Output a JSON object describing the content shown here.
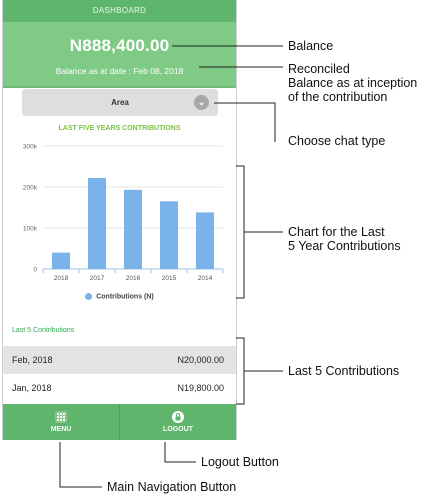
{
  "screen": {
    "header_title": "DASHBOARD",
    "balance": "N888,400.00",
    "balance_date": "Balance as at date : Feb 08, 2018",
    "chart_type_selected": "Area",
    "chart_title": "LAST FIVE YEARS CONTRIBUTIONS",
    "legend_label": "Contributions (N)",
    "last5_title": "Last 5 Contributions",
    "contributions": [
      {
        "date": "Feb, 2018",
        "amount": "N20,000.00"
      },
      {
        "date": "Jan, 2018",
        "amount": "N19,800.00"
      }
    ],
    "nav": {
      "menu": "MENU",
      "logout": "LOGOUT"
    }
  },
  "chart_data": {
    "type": "bar",
    "title": "LAST FIVE YEARS CONTRIBUTIONS",
    "categories": [
      "2018",
      "2017",
      "2016",
      "2015",
      "2014"
    ],
    "series": [
      {
        "name": "Contributions (N)",
        "values": [
          40000,
          222000,
          193000,
          165000,
          138000
        ]
      }
    ],
    "y_ticks": [
      "0",
      "100k",
      "200k",
      "300k"
    ],
    "ylim": [
      0,
      300000
    ],
    "grid": true,
    "legend": "bottom",
    "color": "#79b3ea"
  },
  "annotations": {
    "balance": "Balance",
    "reconciled": "Reconciled\nBalance as at inception\nof the contribution",
    "choose_chart": "Choose chat type",
    "chart_label": "Chart for the Last\n5 Year Contributions",
    "last5": "Last 5 Contributions",
    "logout": "Logout Button",
    "main_nav": "Main Navigation Button"
  },
  "colors": {
    "green_dark": "#5eb56b",
    "green_light": "#7fcb86",
    "bar_blue": "#79b3ea",
    "title_green": "#7bc142"
  }
}
